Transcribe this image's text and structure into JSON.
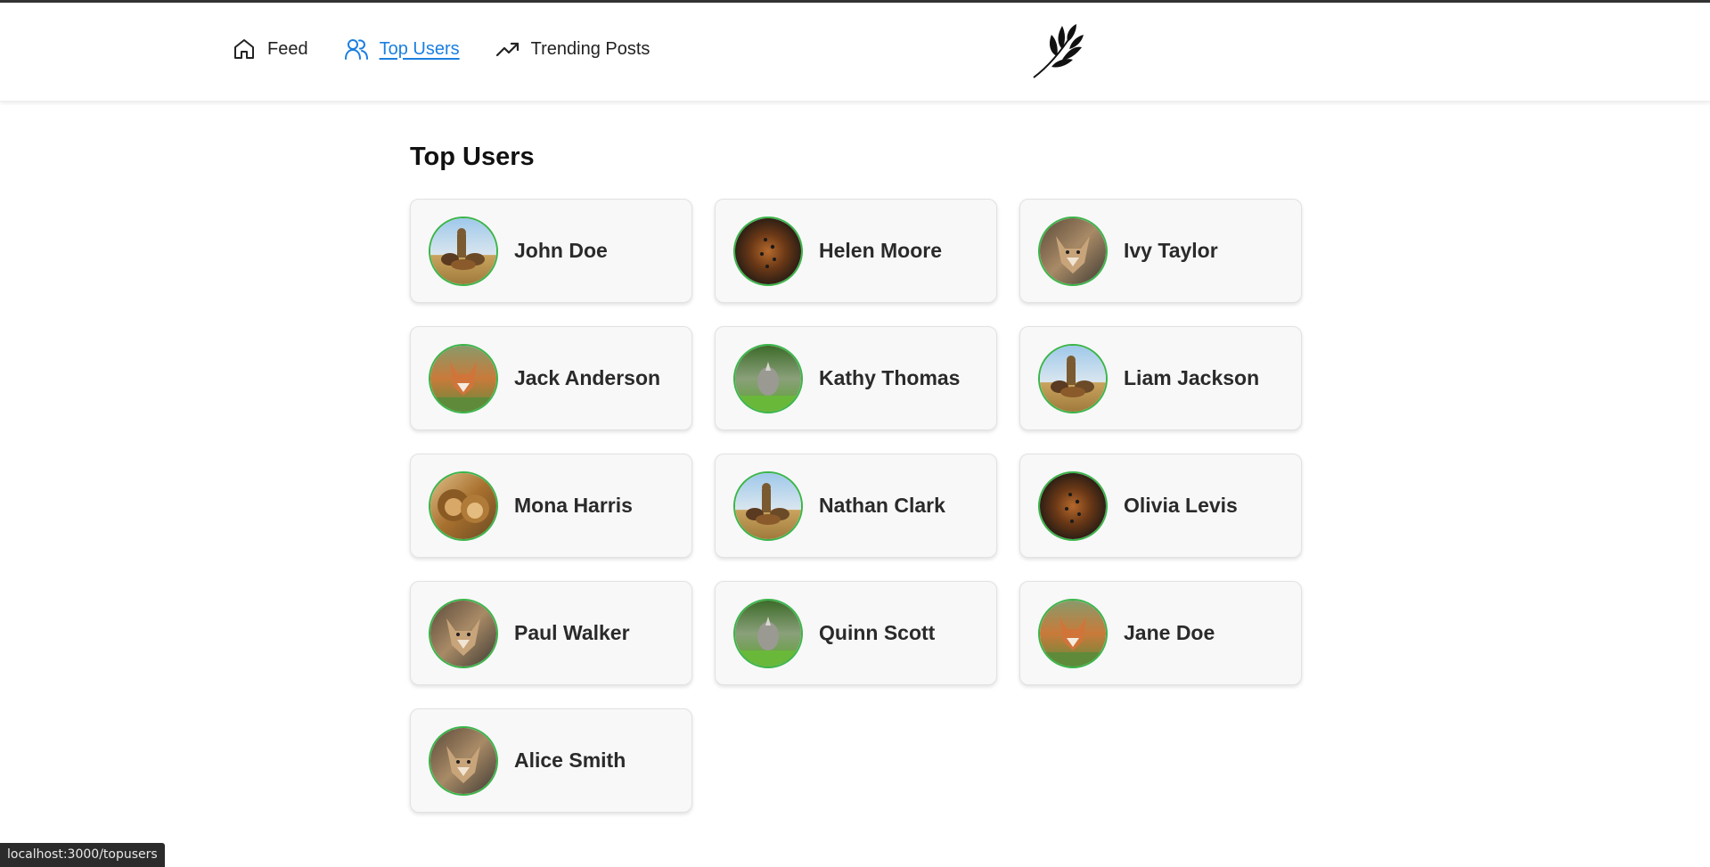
{
  "nav": {
    "items": [
      {
        "label": "Feed",
        "icon": "home-icon",
        "active": false
      },
      {
        "label": "Top Users",
        "icon": "users-icon",
        "active": true
      },
      {
        "label": "Trending Posts",
        "icon": "trending-up-icon",
        "active": false
      }
    ],
    "logo": "leaf-branch-logo",
    "accent_color": "#1a7fe0"
  },
  "page": {
    "title": "Top Users"
  },
  "users": [
    {
      "name": "John Doe",
      "avatar": "safari-animals"
    },
    {
      "name": "Helen Moore",
      "avatar": "leopard-dark"
    },
    {
      "name": "Ivy Taylor",
      "avatar": "wolf"
    },
    {
      "name": "Jack Anderson",
      "avatar": "fox"
    },
    {
      "name": "Kathy Thomas",
      "avatar": "rhino-grass"
    },
    {
      "name": "Liam Jackson",
      "avatar": "safari-animals"
    },
    {
      "name": "Mona Harris",
      "avatar": "lions"
    },
    {
      "name": "Nathan Clark",
      "avatar": "safari-animals"
    },
    {
      "name": "Olivia Levis",
      "avatar": "leopard-dark"
    },
    {
      "name": "Paul Walker",
      "avatar": "wolf"
    },
    {
      "name": "Quinn Scott",
      "avatar": "rhino-grass"
    },
    {
      "name": "Jane Doe",
      "avatar": "fox"
    },
    {
      "name": "Alice Smith",
      "avatar": "wolf"
    }
  ],
  "avatar_border_color": "#3bb54a",
  "status_bar": {
    "url": "localhost:3000/topusers"
  }
}
